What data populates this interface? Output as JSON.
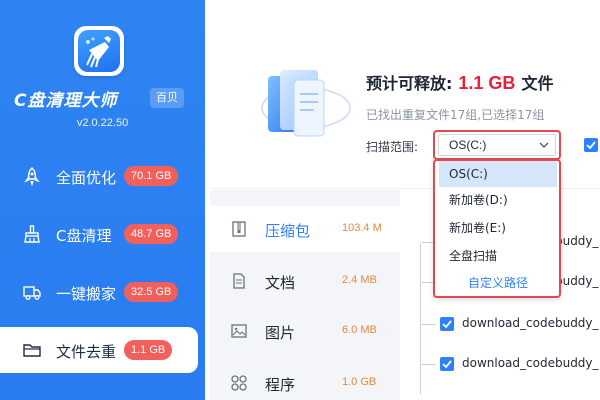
{
  "sidebar": {
    "app_name": "C盘清理大师",
    "badge": "百贝",
    "version": "v2.0.22.50",
    "items": [
      {
        "label": "全面优化",
        "size": "70.1 GB",
        "icon": "rocket-icon"
      },
      {
        "label": "C盘清理",
        "size": "48.7 GB",
        "icon": "broom-icon"
      },
      {
        "label": "一键搬家",
        "size": "32.5 GB",
        "icon": "truck-icon"
      },
      {
        "label": "文件去重",
        "size": "1.1 GB",
        "icon": "folder-icon"
      }
    ]
  },
  "header": {
    "title_prefix": "预计可释放:",
    "amount": "1.1 GB",
    "title_suffix": "文件",
    "subtitle": "已找出重复文件17组,已选择17组",
    "scope_label": "扫描范围:",
    "scope_value": "OS(C:)"
  },
  "dropdown": {
    "options": [
      "OS(C:)",
      "新加卷(D:)",
      "新加卷(E:)",
      "全盘扫描"
    ],
    "custom_path": "自定义路径"
  },
  "categories": [
    {
      "label": "压缩包",
      "size": "103.4 M",
      "icon": "archive-icon"
    },
    {
      "label": "文档",
      "size": "2.4 MB",
      "icon": "document-icon"
    },
    {
      "label": "图片",
      "size": "6.0 MB",
      "icon": "image-icon"
    },
    {
      "label": "程序",
      "size": "1.0 GB",
      "icon": "program-icon"
    }
  ],
  "files": [
    {
      "name": "download_codebuddy_"
    },
    {
      "name": "download_codebuddy_"
    },
    {
      "name": "download_codebuddy_"
    },
    {
      "name": "download_codebuddy_"
    }
  ],
  "colors": {
    "accent": "#2f80ff",
    "highlight": "#e8213b",
    "pill": "#f2605c",
    "size_text": "#e8883b"
  }
}
